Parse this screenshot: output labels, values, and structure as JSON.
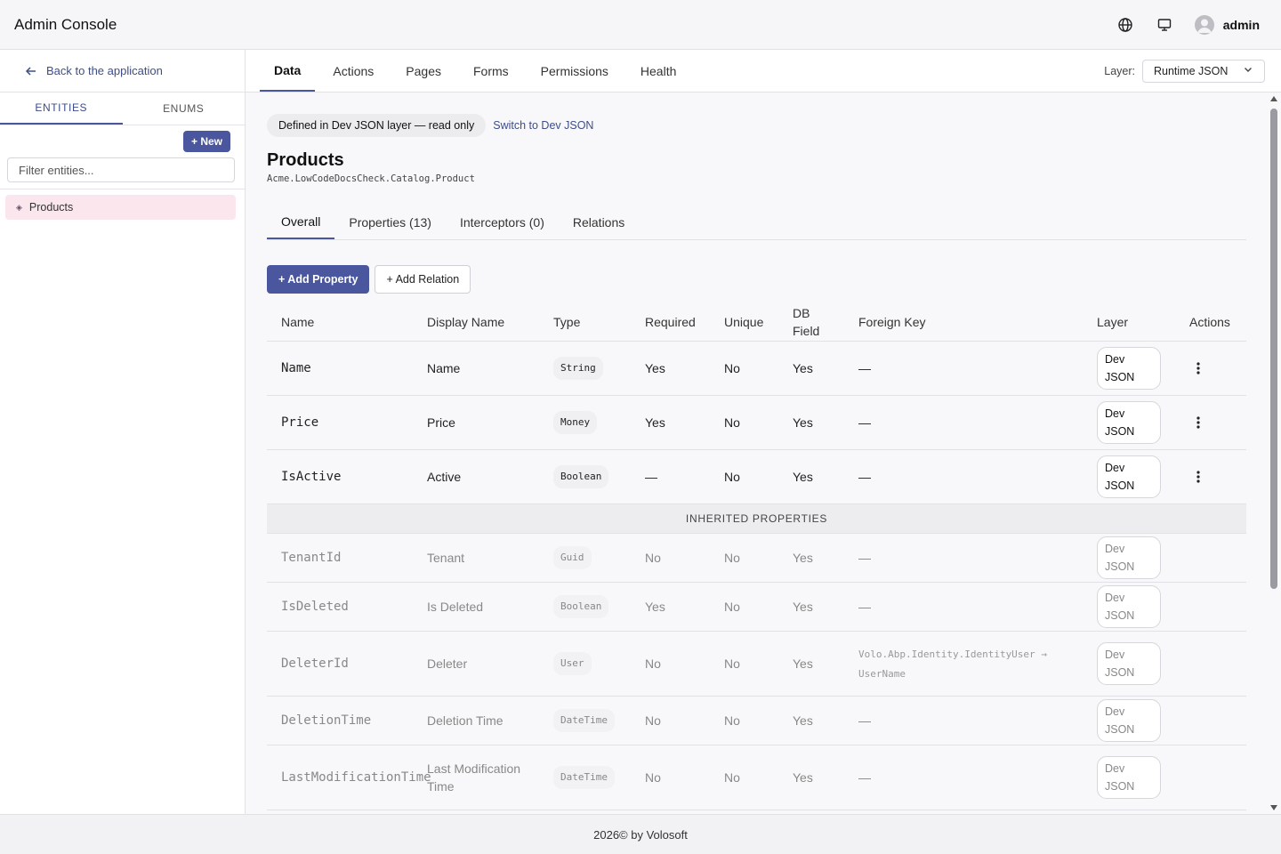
{
  "header": {
    "title": "Admin Console",
    "user": "admin",
    "icons": [
      "globe-icon",
      "monitor-icon",
      "user-avatar-icon"
    ]
  },
  "sidebar": {
    "back_label": "Back to the application",
    "tabs": [
      "ENTITIES",
      "ENUMS"
    ],
    "active_tab": "ENTITIES",
    "new_label": "+ New",
    "filter_placeholder": "Filter entities...",
    "filter_value": "",
    "entities": [
      {
        "label": "Products",
        "selected": true
      }
    ]
  },
  "nav": {
    "tabs": [
      "Data",
      "Actions",
      "Pages",
      "Forms",
      "Permissions",
      "Health"
    ],
    "active_tab": "Data",
    "layer_label": "Layer:",
    "layer_value": "Runtime JSON"
  },
  "content": {
    "notice": "Defined in Dev JSON layer — read only",
    "switch_label": "Switch to Dev JSON",
    "title": "Products",
    "namespace": "Acme.LowCodeDocsCheck.Catalog.Product",
    "tabs": [
      "Overall",
      "Properties (13)",
      "Interceptors (0)",
      "Relations"
    ],
    "active_tab": "Overall",
    "add_property": "+ Add Property",
    "add_relation": "+ Add Relation",
    "columns": {
      "name": "Name",
      "display_name": "Display Name",
      "type": "Type",
      "required": "Required",
      "unique": "Unique",
      "db_field": "DB Field",
      "foreign_key": "Foreign Key",
      "layer": "Layer",
      "actions": "Actions"
    },
    "properties": [
      {
        "name": "Name",
        "display": "Name",
        "type": "String",
        "required": "Yes",
        "unique": "No",
        "db": "Yes",
        "fk": "—",
        "layer": "Dev JSON"
      },
      {
        "name": "Price",
        "display": "Price",
        "type": "Money",
        "required": "Yes",
        "unique": "No",
        "db": "Yes",
        "fk": "—",
        "layer": "Dev JSON"
      },
      {
        "name": "IsActive",
        "display": "Active",
        "type": "Boolean",
        "required": "—",
        "unique": "No",
        "db": "Yes",
        "fk": "—",
        "layer": "Dev JSON"
      }
    ],
    "inherited_header": "INHERITED PROPERTIES",
    "inherited": [
      {
        "name": "TenantId",
        "display": "Tenant",
        "type": "Guid",
        "required": "No",
        "unique": "No",
        "db": "Yes",
        "fk": "—",
        "layer": "Dev JSON"
      },
      {
        "name": "IsDeleted",
        "display": "Is Deleted",
        "type": "Boolean",
        "required": "Yes",
        "unique": "No",
        "db": "Yes",
        "fk": "—",
        "layer": "Dev JSON"
      },
      {
        "name": "DeleterId",
        "display": "Deleter",
        "type": "User",
        "required": "No",
        "unique": "No",
        "db": "Yes",
        "fk": "Volo.Abp.Identity.IdentityUser → UserName",
        "layer": "Dev JSON"
      },
      {
        "name": "DeletionTime",
        "display": "Deletion Time",
        "type": "DateTime",
        "required": "No",
        "unique": "No",
        "db": "Yes",
        "fk": "—",
        "layer": "Dev JSON"
      },
      {
        "name": "LastModificationTime",
        "display": "Last Modification Time",
        "type": "DateTime",
        "required": "No",
        "unique": "No",
        "db": "Yes",
        "fk": "—",
        "layer": "Dev JSON"
      }
    ]
  },
  "footer": {
    "text": "2026© by Volosoft"
  }
}
